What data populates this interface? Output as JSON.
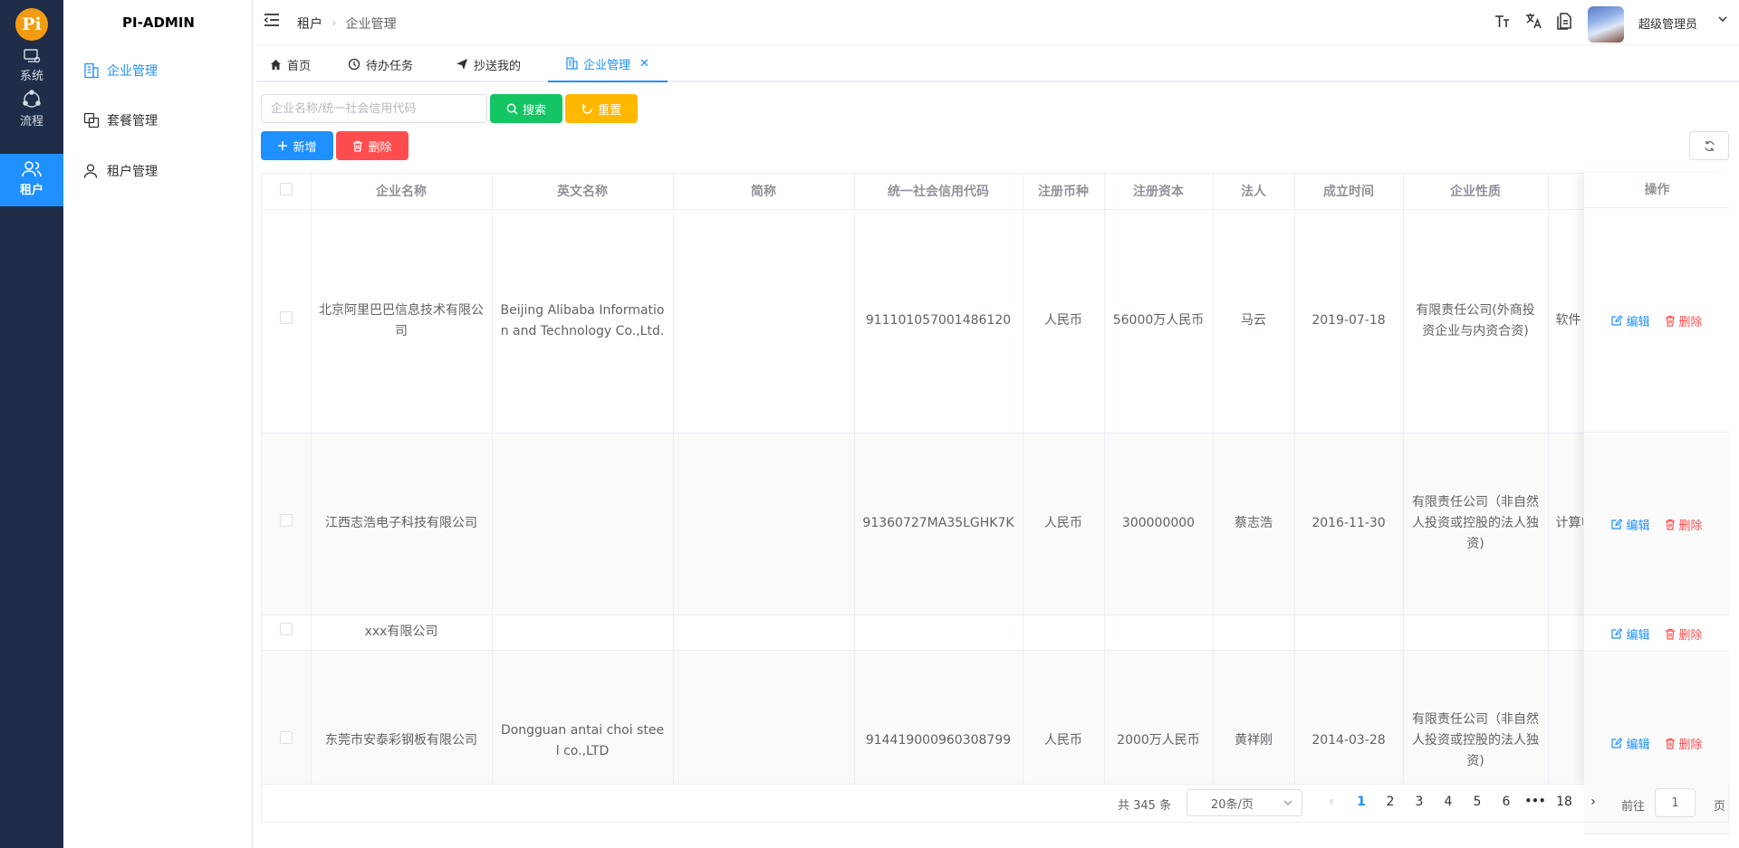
{
  "rail": {
    "logo_text": "Pi",
    "items": [
      {
        "label": "系统",
        "icon": "monitor-icon"
      },
      {
        "label": "流程",
        "icon": "workflow-icon"
      },
      {
        "label": "租户",
        "icon": "users-icon"
      }
    ]
  },
  "menu": {
    "title": "PI-ADMIN",
    "items": [
      {
        "label": "企业管理",
        "icon": "building-icon"
      },
      {
        "label": "套餐管理",
        "icon": "package-icon"
      },
      {
        "label": "租户管理",
        "icon": "user-icon"
      }
    ]
  },
  "header": {
    "breadcrumb": [
      "租户",
      "企业管理"
    ],
    "user_name": "超级管理员",
    "icons": [
      "font-size-icon",
      "translate-icon",
      "document-icon"
    ]
  },
  "tabs": [
    {
      "label": "首页",
      "icon": "home-icon"
    },
    {
      "label": "待办任务",
      "icon": "clock-icon"
    },
    {
      "label": "抄送我的",
      "icon": "send-icon"
    },
    {
      "label": "企业管理",
      "icon": "building-icon",
      "closable": true
    }
  ],
  "toolbar": {
    "search_placeholder": "企业名称/统一社会信用代码",
    "search_label": "搜索",
    "reset_label": "重置",
    "add_label": "新增",
    "delete_label": "删除"
  },
  "table": {
    "columns": [
      "企业名称",
      "英文名称",
      "简称",
      "统一社会信用代码",
      "注册币种",
      "注册资本",
      "法人",
      "成立时间",
      "企业性质",
      ""
    ],
    "ops_header": "操作",
    "edit_label": "编辑",
    "delete_label": "删除",
    "rows": [
      {
        "name": "北京阿里巴巴信息技术有限公司",
        "en_name": "Beijing Alibaba Information and Technology Co.,Ltd.",
        "short": "",
        "code": "911101057001486120",
        "currency": "人民币",
        "capital": "56000万人民币",
        "legal": "马云",
        "founded": "2019-07-18",
        "nature": "有限责任公司(外商投资企业与内资合资)",
        "extra": "软件"
      },
      {
        "name": "江西志浩电子科技有限公司",
        "en_name": "",
        "short": "",
        "code": "91360727MA35LGHK7K",
        "currency": "人民币",
        "capital": "300000000",
        "legal": "蔡志浩",
        "founded": "2016-11-30",
        "nature": "有限责任公司（非自然人投资或控股的法人独资)",
        "extra": "计算电"
      },
      {
        "name": "xxx有限公司",
        "en_name": "",
        "short": "",
        "code": "",
        "currency": "",
        "capital": "",
        "legal": "",
        "founded": "",
        "nature": "",
        "extra": ""
      },
      {
        "name": "东莞市安泰彩钢板有限公司",
        "en_name": "Dongguan antai choi steel co.,LTD",
        "short": "",
        "code": "914419000960308799",
        "currency": "人民币",
        "capital": "2000万人民币",
        "legal": "黄祥刚",
        "founded": "2014-03-28",
        "nature": "有限责任公司（非自然人投资或控股的法人独资)",
        "extra": ""
      }
    ]
  },
  "pagination": {
    "total_text": "共 345 条",
    "page_size": "20条/页",
    "pages": [
      "1",
      "2",
      "3",
      "4",
      "5",
      "6",
      "•••",
      "18"
    ],
    "current": "1",
    "goto_label": "前往",
    "goto_value": "1",
    "page_unit": "页"
  },
  "colors": {
    "primary": "#1e90ff",
    "success": "#13c663",
    "warning": "#ffb800",
    "danger": "#ff4d4f",
    "rail_bg": "#1f2d48"
  }
}
